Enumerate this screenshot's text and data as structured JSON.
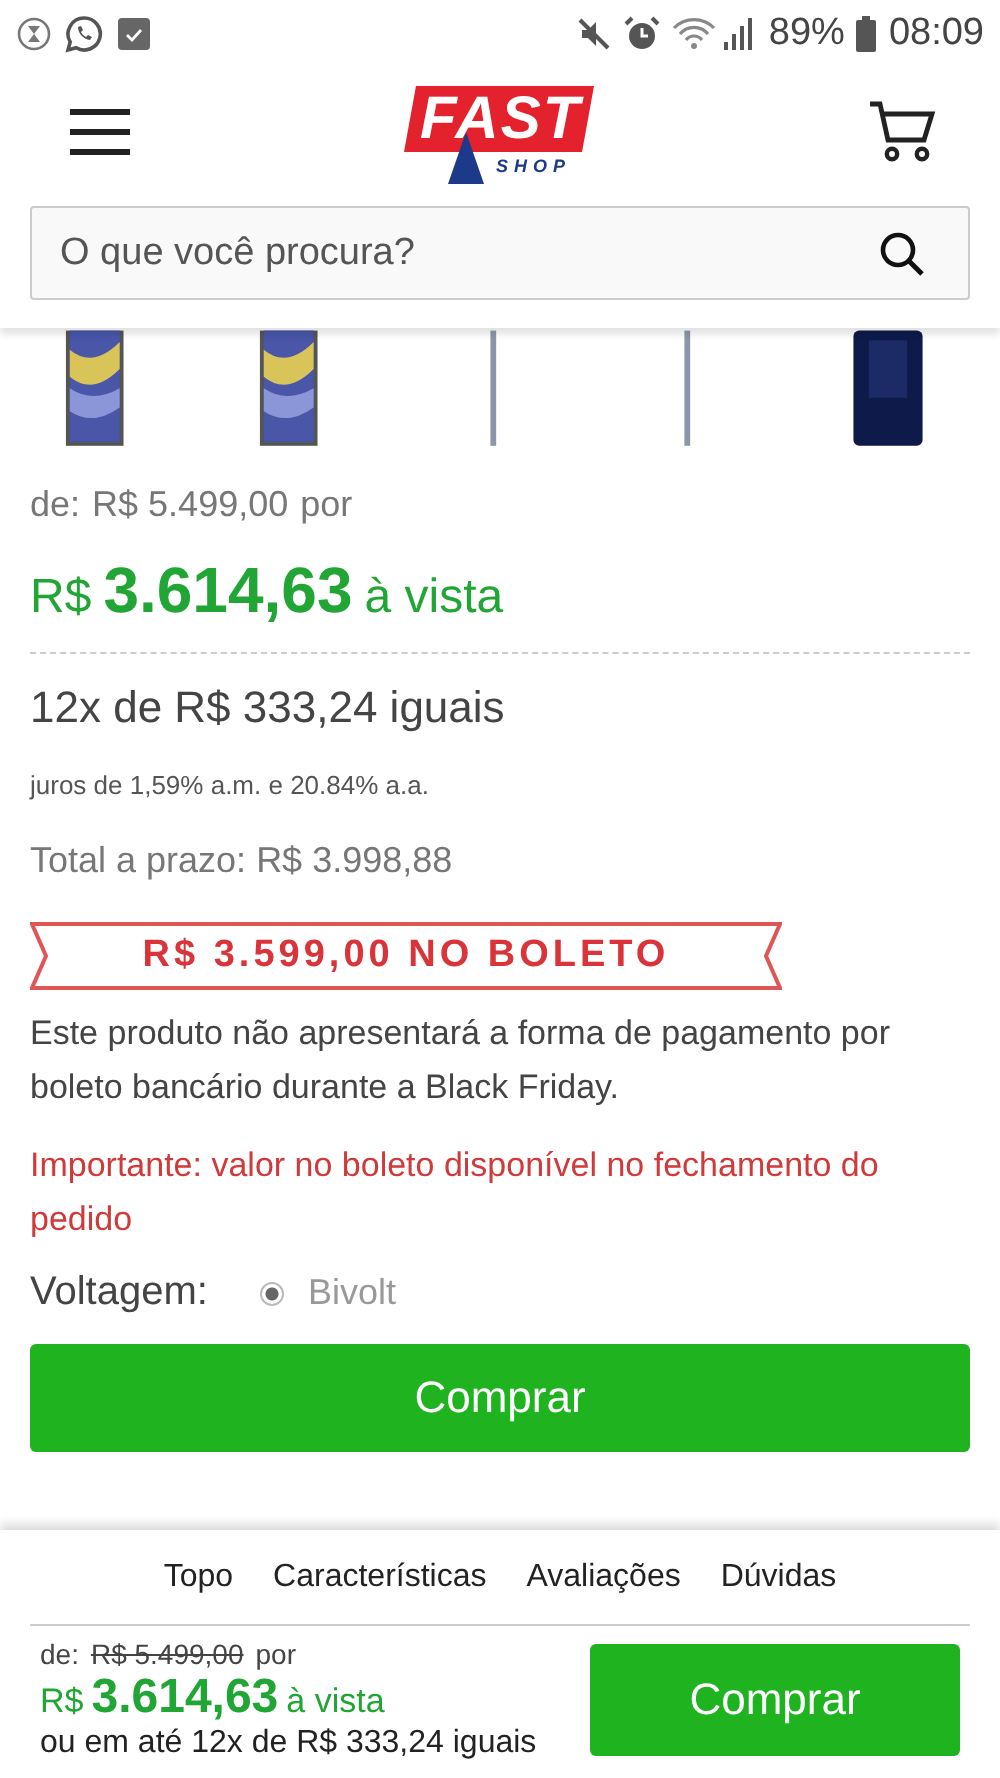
{
  "status_bar": {
    "battery": "89%",
    "time": "08:09"
  },
  "header": {
    "logo": {
      "word": "FAST",
      "sub": "SHOP"
    }
  },
  "search": {
    "placeholder": "O que você procura?"
  },
  "price": {
    "from_label": "de:",
    "old": "R$ 5.499,00",
    "by": "por",
    "currency": "R$",
    "value": "3.614,63",
    "cash": "à vista"
  },
  "installments": "12x de R$ 333,24 iguais",
  "interest": "juros de 1,59% a.m. e 20.84% a.a.",
  "total": "Total a prazo: R$ 3.998,88",
  "boleto_banner": "R$ 3.599,00 NO BOLETO",
  "notice": "Este produto não apresentará a forma de pagamento por boleto bancário durante a Black Friday.",
  "important": "Importante: valor no boleto disponível no fechamento do pedido",
  "voltage": {
    "label": "Voltagem:",
    "options": [
      {
        "label": "Bivolt",
        "selected": true
      }
    ]
  },
  "buy_button": "Comprar",
  "section_nav": [
    {
      "label": "Topo"
    },
    {
      "label": "Características"
    },
    {
      "label": "Avaliações"
    },
    {
      "label": "Dúvidas"
    }
  ],
  "sticky": {
    "from_label": "de:",
    "old": "R$ 5.499,00",
    "by": "por",
    "currency": "R$",
    "value": "3.614,63",
    "cash": "à vista",
    "installments": "ou em até 12x de R$ 333,24 iguais",
    "button": "Comprar"
  }
}
